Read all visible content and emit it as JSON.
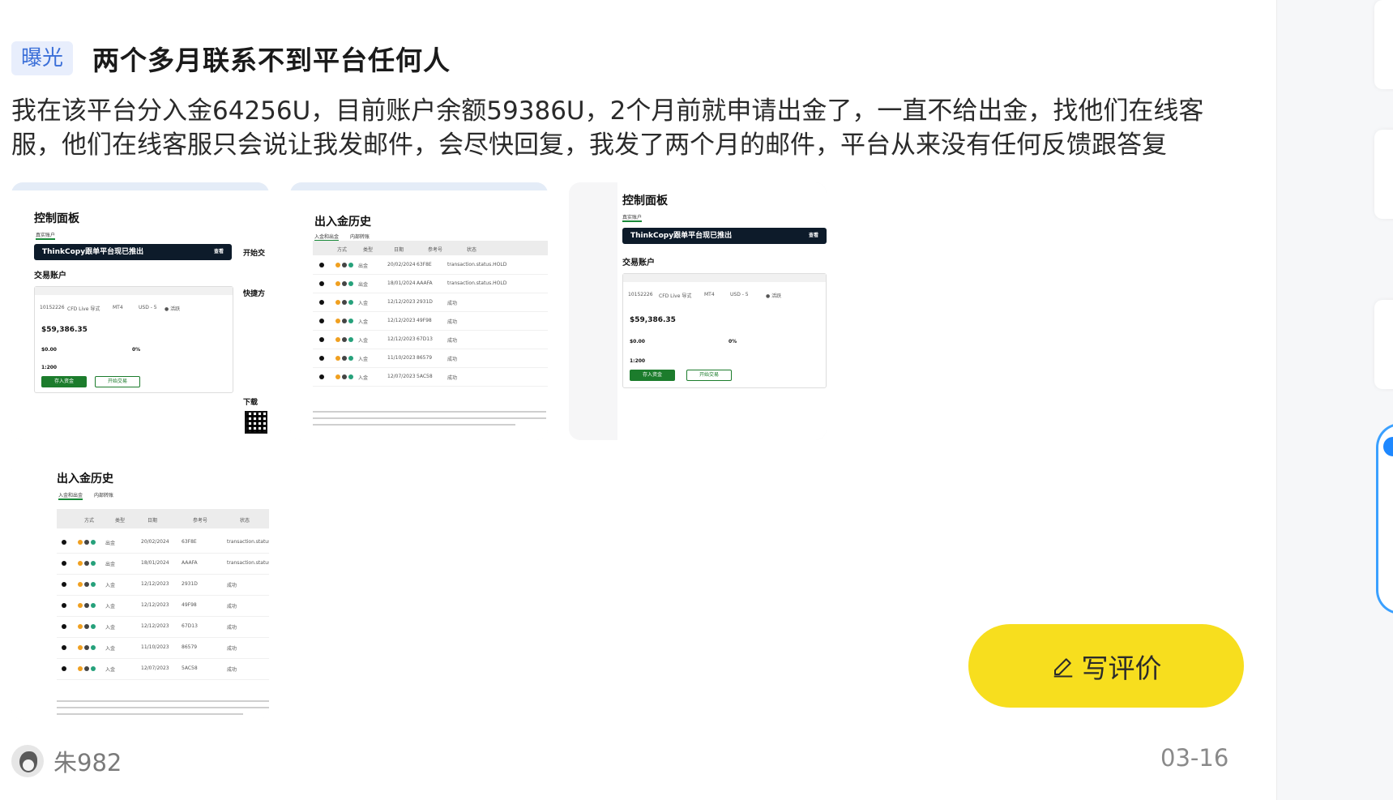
{
  "post": {
    "tag": "曝光",
    "title": "两个多月联系不到平台任何人",
    "body_line1": "我在该平台分入金64256U，目前账户余额59386U，2个月前就申请出金了，一直不给出金，找他们在线客",
    "body_line2": "服，他们在线客服只会说让我发邮件，会尽快回复，我发了两个月的邮件，平台从来没有任何反馈跟答复",
    "author": "朱982",
    "date": "03-16"
  },
  "actions": {
    "write_review": "写评价"
  },
  "thumbnails": {
    "dashboard": {
      "title": "控制面板",
      "tab_active": "真实账户",
      "banner": "ThinkCopy跟单平台现已推出",
      "banner_btn": "查看",
      "trading_accounts": "交易账户",
      "balance": "$59,386.35",
      "credit": "$0.00",
      "margin": "0%",
      "leverage": "1:200",
      "account_no": "10152226",
      "account_type": "CFD Live 导式",
      "platform": "MT4",
      "currency": "USD - 5",
      "status": "● 活跃",
      "deposit_btn": "存入资金",
      "trade_btn": "开始交易",
      "side_start": "开始交",
      "side_quick": "快捷方",
      "side_download": "下载"
    },
    "history": {
      "title": "出入金历史",
      "tab_active": "入金和出金",
      "tab_other": "内部转账",
      "col_method": "方式",
      "col_type": "类型",
      "col_date": "日期",
      "col_ref": "参考号",
      "col_status": "状态",
      "rows": [
        {
          "type": "出金",
          "date": "20/02/2024",
          "ref": "63F8E",
          "status": "transaction.status.HOLD"
        },
        {
          "type": "出金",
          "date": "18/01/2024",
          "ref": "AAAFA",
          "status": "transaction.status.HOLD"
        },
        {
          "type": "入金",
          "date": "12/12/2023",
          "ref": "2931D",
          "status": "成功"
        },
        {
          "type": "入金",
          "date": "12/12/2023",
          "ref": "49F98",
          "status": "成功"
        },
        {
          "type": "入金",
          "date": "12/12/2023",
          "ref": "67D13",
          "status": "成功"
        },
        {
          "type": "入金",
          "date": "11/10/2023",
          "ref": "86579",
          "status": "成功"
        },
        {
          "type": "入金",
          "date": "12/07/2023",
          "ref": "5AC58",
          "status": "成功"
        }
      ]
    }
  },
  "colors": {
    "tag_bg": "#e8eefc",
    "tag_text": "#3b6fd8",
    "button_yellow": "#f7de1e",
    "green": "#1c7c2c",
    "banner_dark": "#0d1b2a"
  },
  "icons": {
    "write": "pencil-icon",
    "avatar": "eagle-avatar"
  }
}
